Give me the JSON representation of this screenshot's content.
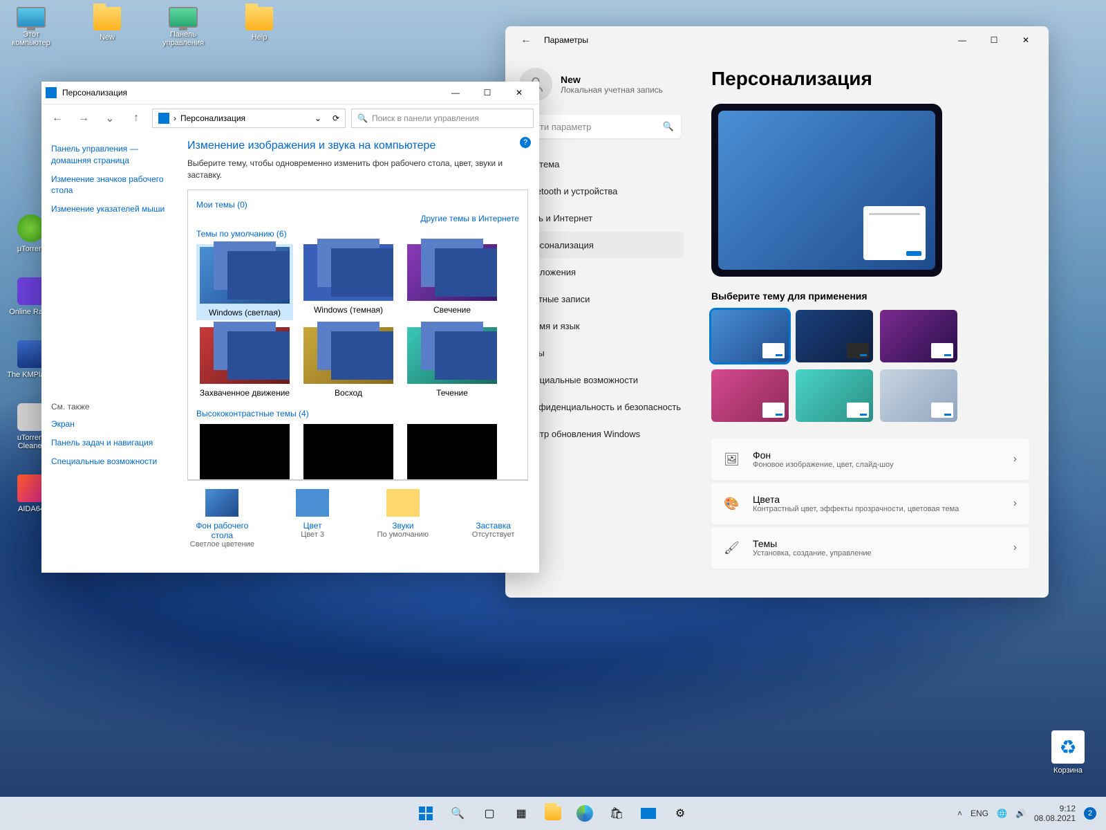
{
  "desktop": {
    "top_icons": [
      {
        "label": "Этот компьютер",
        "type": "pc"
      },
      {
        "label": "New",
        "type": "folder"
      },
      {
        "label": "Панель управления",
        "type": "cp"
      },
      {
        "label": "Help",
        "type": "folder"
      }
    ],
    "left_icons": [
      {
        "label": "μTorrent"
      },
      {
        "label": "Online Radio"
      },
      {
        "label": "The KMPlayer"
      },
      {
        "label": "uTorrent Cleaner"
      },
      {
        "label": "AIDA64"
      }
    ],
    "trash": "Корзина"
  },
  "cp": {
    "title": "Персонализация",
    "breadcrumb": "Персонализация",
    "search_placeholder": "Поиск в панели управления",
    "side_links": [
      "Панель управления — домашняя страница",
      "Изменение значков рабочего стола",
      "Изменение указателей мыши"
    ],
    "see_also_label": "См. также",
    "see_also": [
      "Экран",
      "Панель задач и навигация",
      "Специальные возможности"
    ],
    "heading": "Изменение изображения и звука на компьютере",
    "desc": "Выберите тему, чтобы одновременно изменить фон рабочего стола, цвет, звуки и заставку.",
    "my_themes": "Мои темы (0)",
    "online_link": "Другие темы в Интернете",
    "default_themes": "Темы по умолчанию (6)",
    "themes": [
      {
        "label": "Windows (светлая)",
        "sel": true
      },
      {
        "label": "Windows (темная)"
      },
      {
        "label": "Свечение"
      },
      {
        "label": "Захваченное движение"
      },
      {
        "label": "Восход"
      },
      {
        "label": "Течение"
      }
    ],
    "hc_themes": "Высококонтрастные темы (4)",
    "bottom": [
      {
        "l1": "Фон рабочего стола",
        "l2": "Светлое цветение"
      },
      {
        "l1": "Цвет",
        "l2": "Цвет 3"
      },
      {
        "l1": "Звуки",
        "l2": "По умолчанию"
      },
      {
        "l1": "Заставка",
        "l2": "Отсутствует"
      }
    ]
  },
  "settings": {
    "window_title": "Параметры",
    "user_name": "New",
    "user_desc": "Локальная учетная запись",
    "search_placeholder": "Найти параметр",
    "nav": [
      "Система",
      "Bluetooth и устройства",
      "Сеть и Интернет",
      "Персонализация",
      "Приложения",
      "Учетные записи",
      "Время и язык",
      "Игры",
      "Специальные возможности",
      "Конфиденциальность и безопасность",
      "Центр обновления Windows"
    ],
    "nav_active": 3,
    "page_title": "Персонализация",
    "theme_prompt": "Выберите тему для применения",
    "rows": [
      {
        "icon": "image",
        "t1": "Фон",
        "t2": "Фоновое изображение, цвет, слайд-шоу"
      },
      {
        "icon": "palette",
        "t1": "Цвета",
        "t2": "Контрастный цвет, эффекты прозрачности, цветовая тема"
      },
      {
        "icon": "brush",
        "t1": "Темы",
        "t2": "Установка, создание, управление"
      }
    ]
  },
  "taskbar": {
    "lang": "ENG",
    "time": "9:12",
    "date": "08.08.2021",
    "badge": "2"
  }
}
